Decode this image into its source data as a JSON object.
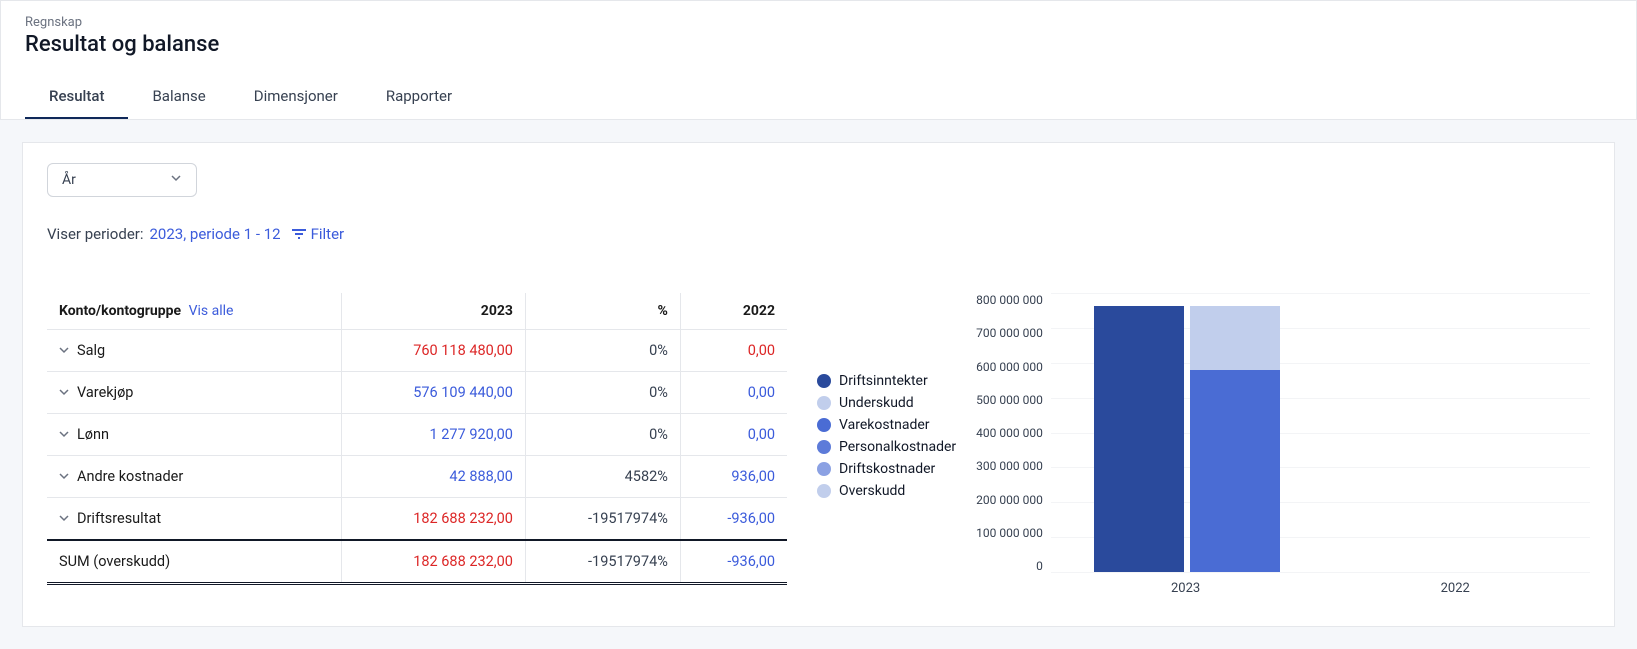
{
  "breadcrumb": "Regnskap",
  "page_title": "Resultat og balanse",
  "tabs": [
    {
      "label": "Resultat",
      "active": true
    },
    {
      "label": "Balanse",
      "active": false
    },
    {
      "label": "Dimensjoner",
      "active": false
    },
    {
      "label": "Rapporter",
      "active": false
    }
  ],
  "period_select_label": "År",
  "period_prefix": "Viser perioder: ",
  "period_value": "2023, periode 1 - 12",
  "filter_label": "Filter",
  "table": {
    "header_name": "Konto/kontogruppe",
    "header_showall": "Vis alle",
    "col_year": "2023",
    "col_pct": "%",
    "col_prev": "2022",
    "rows": [
      {
        "name": "Salg",
        "y2023": "760 118 480,00",
        "y2023_color": "red",
        "pct": "0%",
        "y2022": "0,00",
        "y2022_color": "red"
      },
      {
        "name": "Varekjøp",
        "y2023": "576 109 440,00",
        "y2023_color": "blue",
        "pct": "0%",
        "y2022": "0,00",
        "y2022_color": "blue"
      },
      {
        "name": "Lønn",
        "y2023": "1 277 920,00",
        "y2023_color": "blue",
        "pct": "0%",
        "y2022": "0,00",
        "y2022_color": "blue"
      },
      {
        "name": "Andre kostnader",
        "y2023": "42 888,00",
        "y2023_color": "blue",
        "pct": "4582%",
        "y2022": "936,00",
        "y2022_color": "blue"
      },
      {
        "name": "Driftsresultat",
        "y2023": "182 688 232,00",
        "y2023_color": "red",
        "pct": "-19517974%",
        "y2022": "-936,00",
        "y2022_color": "blue"
      }
    ],
    "sum_label": "SUM (overskudd)",
    "sum_y2023": "182 688 232,00",
    "sum_pct": "-19517974%",
    "sum_y2022": "-936,00"
  },
  "legend": [
    {
      "label": "Driftsinntekter",
      "color": "#2a4a9c"
    },
    {
      "label": "Underskudd",
      "color": "#c1ceec"
    },
    {
      "label": "Varekostnader",
      "color": "#4a6cd4"
    },
    {
      "label": "Personalkostnader",
      "color": "#5d7bd9"
    },
    {
      "label": "Driftskostnader",
      "color": "#8ba1e3"
    },
    {
      "label": "Overskudd",
      "color": "#c1ceec"
    }
  ],
  "chart_data": {
    "type": "bar",
    "categories": [
      "2023",
      "2022"
    ],
    "ylim": [
      0,
      800000000
    ],
    "yticks": [
      "800 000 000",
      "700 000 000",
      "600 000 000",
      "500 000 000",
      "400 000 000",
      "300 000 000",
      "200 000 000",
      "100 000 000",
      "0"
    ],
    "series": [
      {
        "name": "Driftsinntekter",
        "color": "#2a4a9c",
        "values": [
          760118480,
          0
        ]
      },
      {
        "name": "Varekostnader",
        "color": "#4a6cd4",
        "values": [
          576109440,
          0
        ]
      },
      {
        "name": "Personalkostnader",
        "color": "#5d7bd9",
        "values": [
          1277920,
          0
        ]
      },
      {
        "name": "Driftskostnader",
        "color": "#8ba1e3",
        "values": [
          42888,
          0
        ]
      },
      {
        "name": "Overskudd",
        "color": "#c1ceec",
        "values": [
          182688232,
          0
        ]
      }
    ],
    "bars": [
      {
        "category": "2023",
        "stacks": [
          {
            "bar": 0,
            "color": "#2a4a9c",
            "value": 760118480
          },
          {
            "bar": 1,
            "color": "#4a6cd4",
            "value": 576109440
          },
          {
            "bar": 1,
            "color": "#5d7bd9",
            "value": 1277920
          },
          {
            "bar": 1,
            "color": "#8ba1e3",
            "value": 42888
          },
          {
            "bar": 1,
            "color": "#c1ceec",
            "value": 182688232
          }
        ]
      },
      {
        "category": "2022",
        "stacks": []
      }
    ]
  }
}
